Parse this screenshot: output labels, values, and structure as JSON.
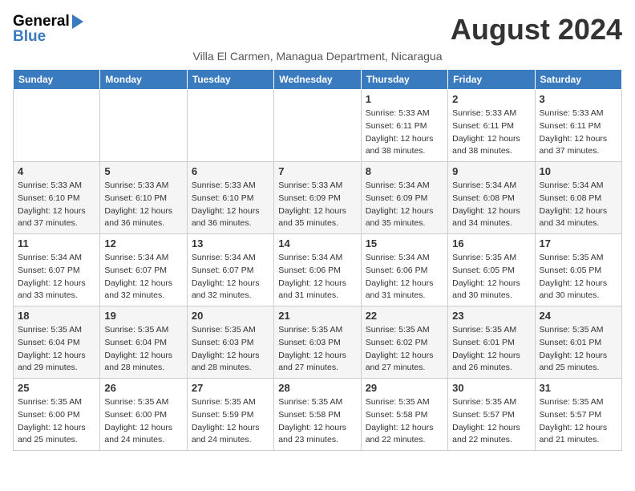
{
  "header": {
    "logo_general": "General",
    "logo_blue": "Blue",
    "month_title": "August 2024",
    "subtitle": "Villa El Carmen, Managua Department, Nicaragua"
  },
  "days_of_week": [
    "Sunday",
    "Monday",
    "Tuesday",
    "Wednesday",
    "Thursday",
    "Friday",
    "Saturday"
  ],
  "weeks": [
    [
      {
        "day": "",
        "info": ""
      },
      {
        "day": "",
        "info": ""
      },
      {
        "day": "",
        "info": ""
      },
      {
        "day": "",
        "info": ""
      },
      {
        "day": "1",
        "info": "Sunrise: 5:33 AM\nSunset: 6:11 PM\nDaylight: 12 hours\nand 38 minutes."
      },
      {
        "day": "2",
        "info": "Sunrise: 5:33 AM\nSunset: 6:11 PM\nDaylight: 12 hours\nand 38 minutes."
      },
      {
        "day": "3",
        "info": "Sunrise: 5:33 AM\nSunset: 6:11 PM\nDaylight: 12 hours\nand 37 minutes."
      }
    ],
    [
      {
        "day": "4",
        "info": "Sunrise: 5:33 AM\nSunset: 6:10 PM\nDaylight: 12 hours\nand 37 minutes."
      },
      {
        "day": "5",
        "info": "Sunrise: 5:33 AM\nSunset: 6:10 PM\nDaylight: 12 hours\nand 36 minutes."
      },
      {
        "day": "6",
        "info": "Sunrise: 5:33 AM\nSunset: 6:10 PM\nDaylight: 12 hours\nand 36 minutes."
      },
      {
        "day": "7",
        "info": "Sunrise: 5:33 AM\nSunset: 6:09 PM\nDaylight: 12 hours\nand 35 minutes."
      },
      {
        "day": "8",
        "info": "Sunrise: 5:34 AM\nSunset: 6:09 PM\nDaylight: 12 hours\nand 35 minutes."
      },
      {
        "day": "9",
        "info": "Sunrise: 5:34 AM\nSunset: 6:08 PM\nDaylight: 12 hours\nand 34 minutes."
      },
      {
        "day": "10",
        "info": "Sunrise: 5:34 AM\nSunset: 6:08 PM\nDaylight: 12 hours\nand 34 minutes."
      }
    ],
    [
      {
        "day": "11",
        "info": "Sunrise: 5:34 AM\nSunset: 6:07 PM\nDaylight: 12 hours\nand 33 minutes."
      },
      {
        "day": "12",
        "info": "Sunrise: 5:34 AM\nSunset: 6:07 PM\nDaylight: 12 hours\nand 32 minutes."
      },
      {
        "day": "13",
        "info": "Sunrise: 5:34 AM\nSunset: 6:07 PM\nDaylight: 12 hours\nand 32 minutes."
      },
      {
        "day": "14",
        "info": "Sunrise: 5:34 AM\nSunset: 6:06 PM\nDaylight: 12 hours\nand 31 minutes."
      },
      {
        "day": "15",
        "info": "Sunrise: 5:34 AM\nSunset: 6:06 PM\nDaylight: 12 hours\nand 31 minutes."
      },
      {
        "day": "16",
        "info": "Sunrise: 5:35 AM\nSunset: 6:05 PM\nDaylight: 12 hours\nand 30 minutes."
      },
      {
        "day": "17",
        "info": "Sunrise: 5:35 AM\nSunset: 6:05 PM\nDaylight: 12 hours\nand 30 minutes."
      }
    ],
    [
      {
        "day": "18",
        "info": "Sunrise: 5:35 AM\nSunset: 6:04 PM\nDaylight: 12 hours\nand 29 minutes."
      },
      {
        "day": "19",
        "info": "Sunrise: 5:35 AM\nSunset: 6:04 PM\nDaylight: 12 hours\nand 28 minutes."
      },
      {
        "day": "20",
        "info": "Sunrise: 5:35 AM\nSunset: 6:03 PM\nDaylight: 12 hours\nand 28 minutes."
      },
      {
        "day": "21",
        "info": "Sunrise: 5:35 AM\nSunset: 6:03 PM\nDaylight: 12 hours\nand 27 minutes."
      },
      {
        "day": "22",
        "info": "Sunrise: 5:35 AM\nSunset: 6:02 PM\nDaylight: 12 hours\nand 27 minutes."
      },
      {
        "day": "23",
        "info": "Sunrise: 5:35 AM\nSunset: 6:01 PM\nDaylight: 12 hours\nand 26 minutes."
      },
      {
        "day": "24",
        "info": "Sunrise: 5:35 AM\nSunset: 6:01 PM\nDaylight: 12 hours\nand 25 minutes."
      }
    ],
    [
      {
        "day": "25",
        "info": "Sunrise: 5:35 AM\nSunset: 6:00 PM\nDaylight: 12 hours\nand 25 minutes."
      },
      {
        "day": "26",
        "info": "Sunrise: 5:35 AM\nSunset: 6:00 PM\nDaylight: 12 hours\nand 24 minutes."
      },
      {
        "day": "27",
        "info": "Sunrise: 5:35 AM\nSunset: 5:59 PM\nDaylight: 12 hours\nand 24 minutes."
      },
      {
        "day": "28",
        "info": "Sunrise: 5:35 AM\nSunset: 5:58 PM\nDaylight: 12 hours\nand 23 minutes."
      },
      {
        "day": "29",
        "info": "Sunrise: 5:35 AM\nSunset: 5:58 PM\nDaylight: 12 hours\nand 22 minutes."
      },
      {
        "day": "30",
        "info": "Sunrise: 5:35 AM\nSunset: 5:57 PM\nDaylight: 12 hours\nand 22 minutes."
      },
      {
        "day": "31",
        "info": "Sunrise: 5:35 AM\nSunset: 5:57 PM\nDaylight: 12 hours\nand 21 minutes."
      }
    ]
  ]
}
